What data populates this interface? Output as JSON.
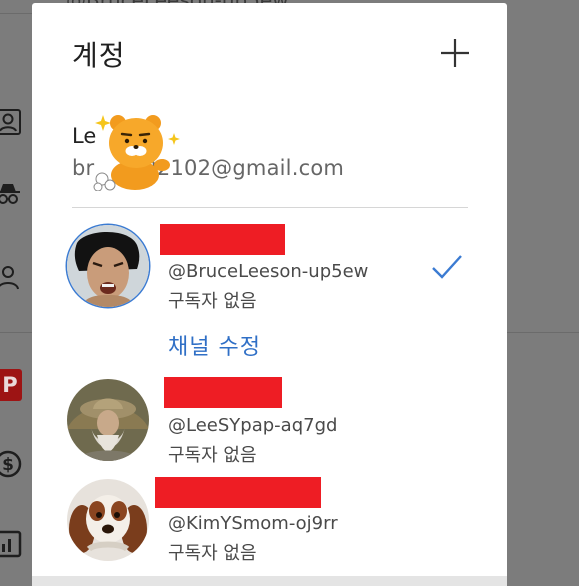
{
  "background": {
    "top_text": "@BruceLeeson-up5ew",
    "premium_badge": "P",
    "icons": [
      "person-icon",
      "incognito-icon",
      "person-outline-icon",
      "premium-icon",
      "dollar-icon",
      "stats-icon"
    ]
  },
  "dialog": {
    "title": "계정",
    "add_button_icon": "plus-icon",
    "account": {
      "name": "Le",
      "email": "bru…92102@gmail.com",
      "email_start": "br",
      "email_end": "92102@gmail.com"
    },
    "channels": [
      {
        "name_redacted": true,
        "handle": "@BruceLeeson-up5ew",
        "subscribers": "구독자 없음",
        "selected": true,
        "edit_label": "채널 수정"
      },
      {
        "name_redacted": true,
        "handle": "@LeeSYpap-aq7gd",
        "subscribers": "구독자 없음",
        "selected": false
      },
      {
        "name_redacted": true,
        "handle": "@KimYSmom-oj9rr",
        "subscribers": "구독자 없음",
        "selected": false
      }
    ]
  },
  "colors": {
    "accent": "#2f6fc6",
    "redaction": "#ee1d24",
    "scrim": "#7c7c7c"
  }
}
